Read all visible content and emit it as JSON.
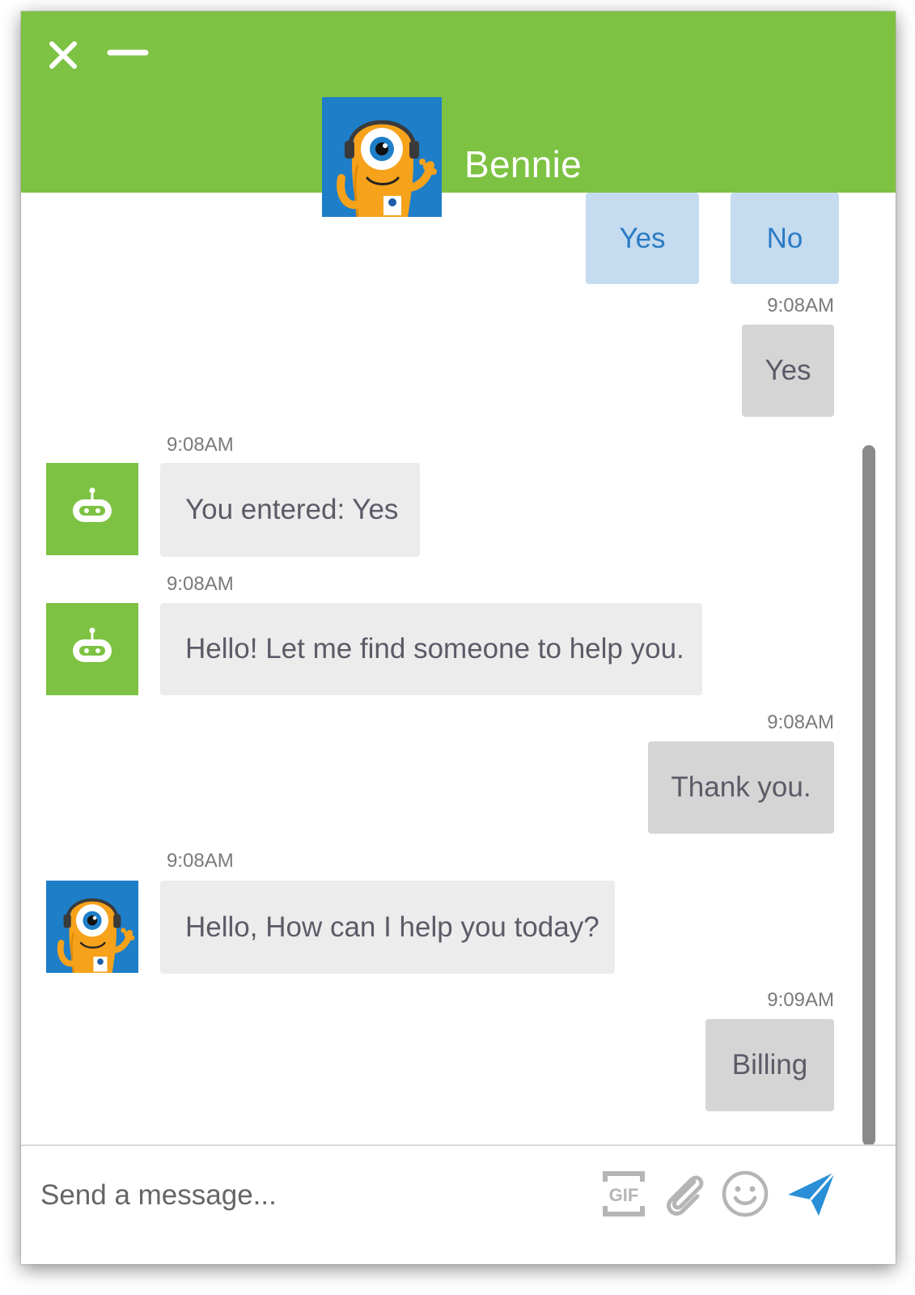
{
  "header": {
    "agent_name": "Bennie",
    "close_icon": "close-icon",
    "minimize_icon": "minimize-icon",
    "color": "#7dc242"
  },
  "quick_replies": [
    {
      "label": "Yes"
    },
    {
      "label": "No"
    }
  ],
  "messages": [
    {
      "sender": "user",
      "time": "9:08AM",
      "text": "Yes"
    },
    {
      "sender": "bot",
      "avatar": "robot-icon",
      "time": "9:08AM",
      "text": "You entered: Yes"
    },
    {
      "sender": "bot",
      "avatar": "robot-icon",
      "time": "9:08AM",
      "text": "Hello! Let me find someone to help you."
    },
    {
      "sender": "user",
      "time": "9:08AM",
      "text": "Thank you."
    },
    {
      "sender": "agent",
      "avatar": "monster-avatar",
      "time": "9:08AM",
      "text": "Hello, How can I help you today?"
    },
    {
      "sender": "user",
      "time": "9:09AM",
      "text": "Billing"
    }
  ],
  "composer": {
    "placeholder": "Send a message...",
    "gif_label": "GIF",
    "tools": [
      "gif-icon",
      "paperclip-icon",
      "smiley-icon",
      "send-icon"
    ]
  },
  "colors": {
    "accent": "#7dc242",
    "quick_reply_bg": "#c5dbef",
    "quick_reply_text": "#2a7bc4",
    "send": "#2a8fd6"
  }
}
